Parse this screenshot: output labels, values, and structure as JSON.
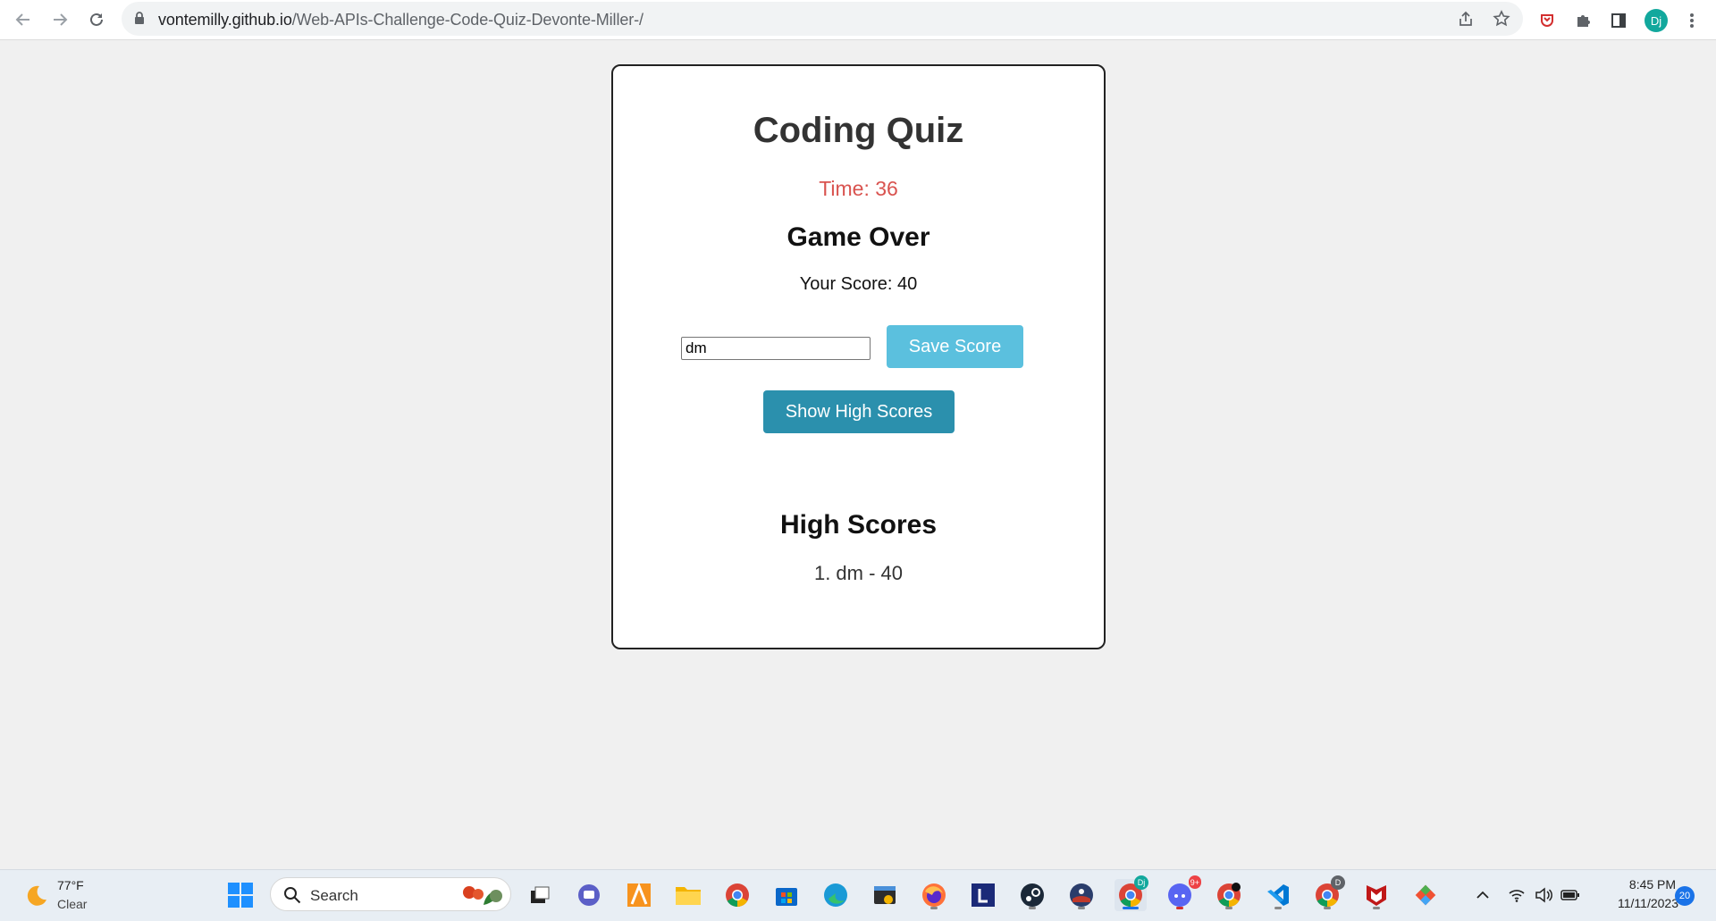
{
  "browser": {
    "url_domain": "vontemilly.github.io",
    "url_path": "/Web-APIs-Challenge-Code-Quiz-Devonte-Miller-/",
    "profile_initials": "Dj",
    "icons": [
      "back-arrow-icon",
      "forward-arrow-icon",
      "reload-icon",
      "lock-icon",
      "share-icon",
      "bookmark-star-icon",
      "extension-shield-icon",
      "puzzle-icon",
      "side-panel-icon",
      "profile-avatar",
      "kebab-menu-icon"
    ]
  },
  "quiz": {
    "title": "Coding Quiz",
    "timer": "Time: 36",
    "game_over": "Game Over",
    "score_text": "Your Score: 40",
    "initials_value": "dm",
    "save_label": "Save Score",
    "show_label": "Show High Scores",
    "high_scores_title": "High Scores",
    "high_scores": [
      "1. dm - 40"
    ],
    "colors": {
      "timer": "#d9534f",
      "save_button": "#5bc0de",
      "show_button": "#2b90ad"
    }
  },
  "taskbar": {
    "temperature": "77°F",
    "condition": "Clear",
    "search_label": "Search",
    "time": "8:45 PM",
    "date": "11/11/2023",
    "notification_count": "20",
    "badge_discord": "9+",
    "badge_chrome_profile": "Dj",
    "badge_chrome_second": "D",
    "pinned_icons": [
      "start-icon",
      "search-icon",
      "task-view-icon",
      "teams-chat-icon",
      "app-orange-icon",
      "file-explorer-icon",
      "chrome-icon",
      "ms-store-icon",
      "edge-icon",
      "terminal-icon",
      "firefox-icon",
      "l-app-icon",
      "steam-icon",
      "game-app-icon",
      "chrome-profile-icon",
      "discord-icon",
      "chrome-alt-icon",
      "vscode-icon",
      "chrome-d-icon",
      "mcafee-icon",
      "git-icon"
    ],
    "tray_icons": [
      "chevron-up-icon",
      "wifi-icon",
      "volume-icon",
      "battery-icon"
    ]
  }
}
